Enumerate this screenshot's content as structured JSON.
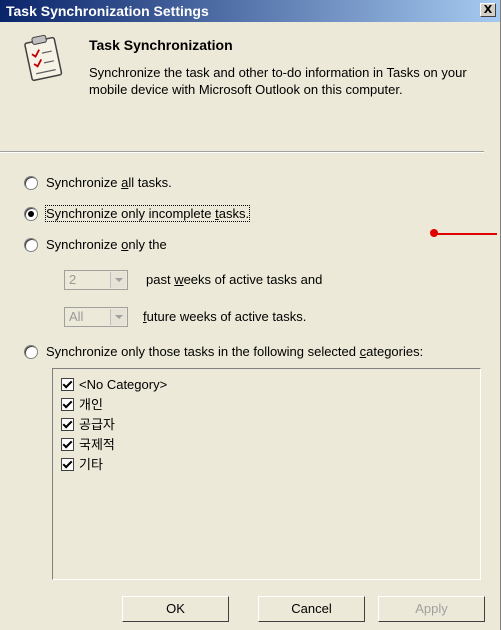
{
  "window": {
    "title": "Task Synchronization Settings",
    "close_label": "X"
  },
  "header": {
    "title": "Task Synchronization",
    "description": "Synchronize the task and other to-do information in Tasks on your mobile device with Microsoft Outlook on this computer."
  },
  "options": {
    "all": {
      "pre": "Synchronize ",
      "accel": "a",
      "post": "ll tasks.",
      "checked": false
    },
    "incomplete": {
      "pre": "Synchronize only incomplete ",
      "accel": "t",
      "post": "asks.",
      "checked": true
    },
    "only_the": {
      "pre": "Synchronize ",
      "accel": "o",
      "post": "nly the",
      "checked": false
    },
    "categories": {
      "pre": "Synchronize only those tasks in the following selected ",
      "accel": "c",
      "post": "ategories:",
      "checked": false
    }
  },
  "past_weeks": {
    "value": "2",
    "label_pre": "past ",
    "label_accel": "w",
    "label_post": "eeks of active tasks and"
  },
  "future_weeks": {
    "value": "All",
    "label_accel": "f",
    "label_post": "uture weeks of active tasks."
  },
  "categories": [
    "<No Category>",
    "개인",
    "공급자",
    "국제적",
    "기타"
  ],
  "buttons": {
    "ok": "OK",
    "cancel": "Cancel",
    "apply": "Apply"
  },
  "colors": {
    "titlebar_start": "#0a246a",
    "titlebar_end": "#a6caf0",
    "annotation": "#e00000"
  }
}
